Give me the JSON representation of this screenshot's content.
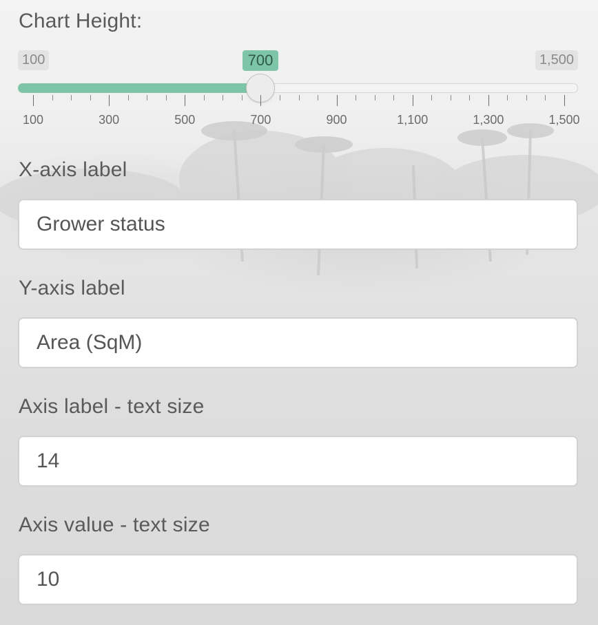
{
  "chart_height": {
    "label": "Chart Height:",
    "min_label": "100",
    "max_label": "1,500",
    "value_label": "700",
    "min": 100,
    "max": 1500,
    "value": 700,
    "step": 50,
    "major_ticks": [
      "100",
      "300",
      "500",
      "700",
      "900",
      "1,100",
      "1,300",
      "1,500"
    ],
    "accent_color": "#7dc4a8"
  },
  "x_axis": {
    "label": "X-axis label",
    "value": "Grower status"
  },
  "y_axis": {
    "label": "Y-axis label",
    "value": "Area (SqM)"
  },
  "axis_label_size": {
    "label": "Axis label - text size",
    "value": "14"
  },
  "axis_value_size": {
    "label": "Axis value - text size",
    "value": "10"
  }
}
